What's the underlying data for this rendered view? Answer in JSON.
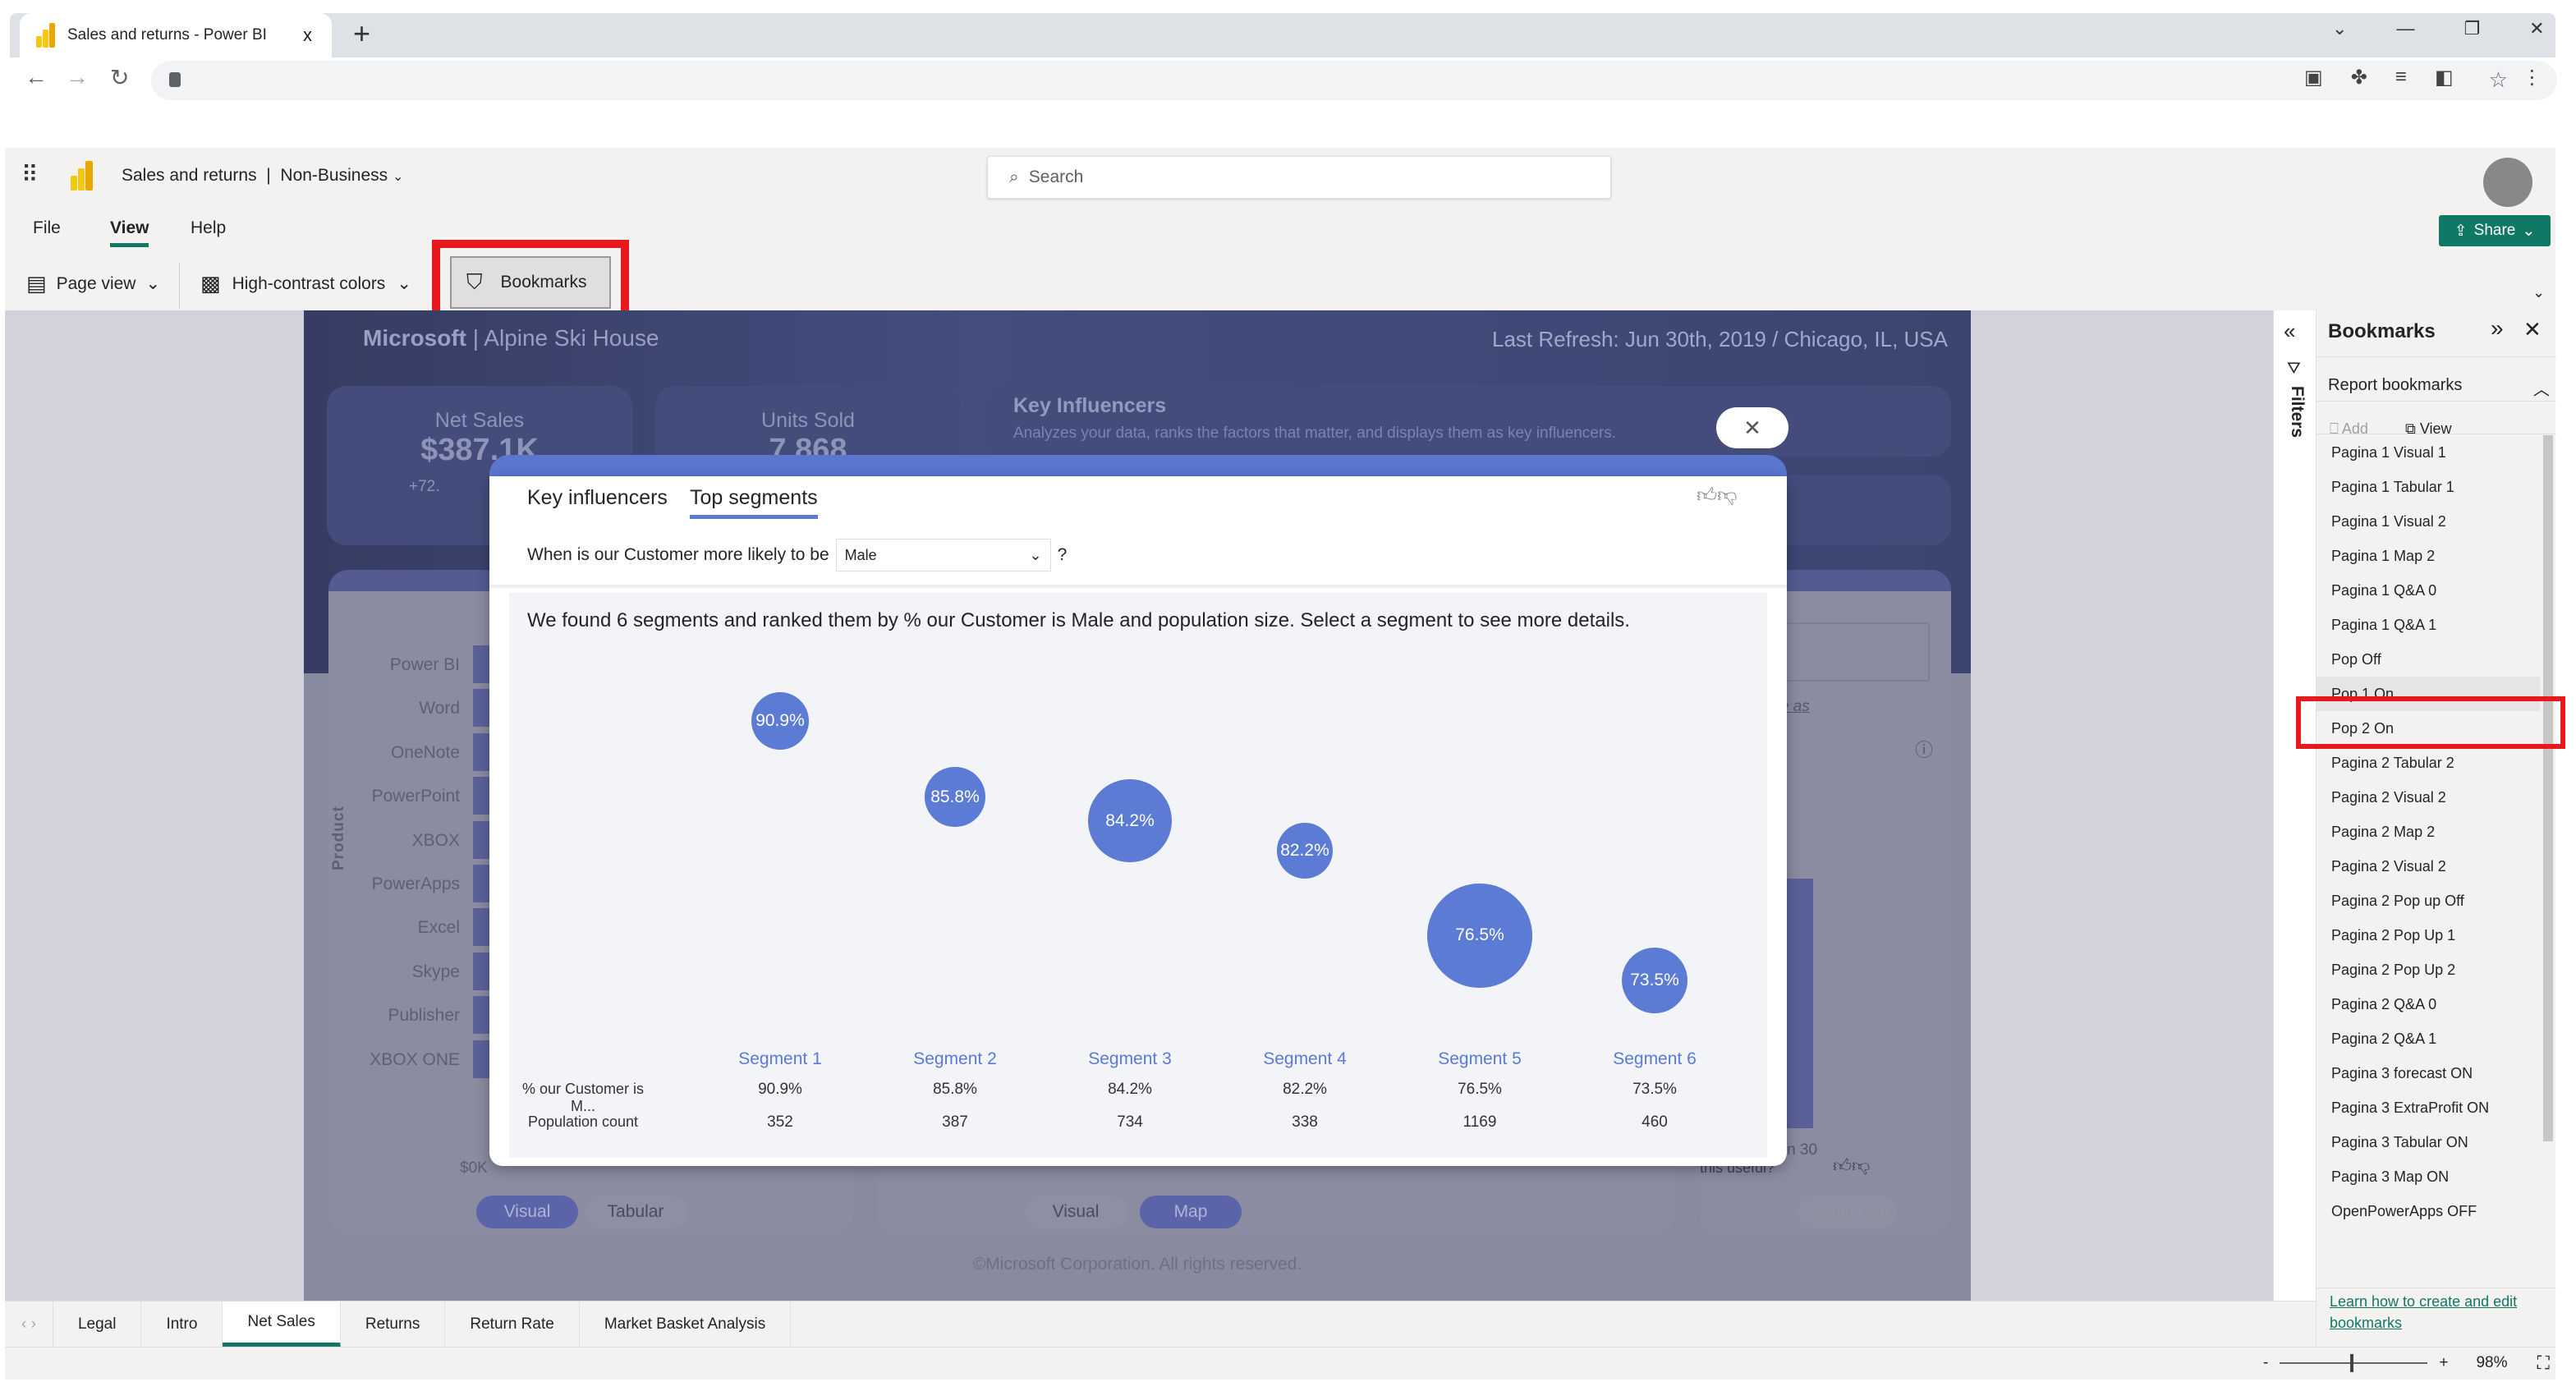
{
  "browser": {
    "tab_title": "Sales and returns - Power BI",
    "close": "x",
    "new_tab": "+",
    "win_controls": [
      "⌄",
      "—",
      "❐",
      "✕"
    ]
  },
  "app": {
    "title": "Sales and returns",
    "workspace": "Non-Business",
    "search_placeholder": "Search",
    "share": "Share",
    "menu": [
      "File",
      "View",
      "Help"
    ],
    "active_menu": "View",
    "toolbar": {
      "page_view": "Page view",
      "high_contrast": "High-contrast colors",
      "bookmarks": "Bookmarks"
    }
  },
  "report": {
    "brand": "Microsoft",
    "subbrand": "Alpine Ski House",
    "last_refresh": "Last Refresh: Jun 30th, 2019 / Chicago, IL, USA",
    "kpis": [
      {
        "label": "Net Sales",
        "value": "$387.1K",
        "sub": "+72.",
        "sub2": "-- "
      },
      {
        "label": "Units Sold",
        "value": "7,868"
      }
    ],
    "ki_title": "Key Influencers",
    "ki_desc": "Analyzes your data, ranks the factors that matter, and displays them as key influencers.",
    "products": [
      "Power BI",
      "Word",
      "OneNote",
      "PowerPoint",
      "XBOX",
      "PowerApps",
      "Excel",
      "Skype",
      "Publisher",
      "XBOX ONE"
    ],
    "product_axis": "Product",
    "axis_zero": "$0K",
    "date_label": "Jun 30",
    "link_text": "by sale date as",
    "useful": "this useful?",
    "card1_buttons": [
      "Visual",
      "Tabular"
    ],
    "card2_buttons": [
      "Visual",
      "Map"
    ],
    "card3_button": "Restart Q&A",
    "footer": "©Microsoft Corporation. All rights reserved."
  },
  "popup": {
    "close": "✕",
    "tabs": [
      "Key influencers",
      "Top segments"
    ],
    "active_tab": "Top segments",
    "question_prefix": "When is our Customer more likely to be",
    "question_value": "Male",
    "question_suffix": "?",
    "summary": "We found 6 segments and ranked them by % our Customer is Male and population size. Select a segment to see more details.",
    "row_labels": [
      "% our Customer is M...",
      "Population count"
    ],
    "segments": [
      {
        "name": "Segment 1",
        "pct": 90.9,
        "pct_label": "90.9%",
        "population": 352
      },
      {
        "name": "Segment 2",
        "pct": 85.8,
        "pct_label": "85.8%",
        "population": 387
      },
      {
        "name": "Segment 3",
        "pct": 84.2,
        "pct_label": "84.2%",
        "population": 734
      },
      {
        "name": "Segment 4",
        "pct": 82.2,
        "pct_label": "82.2%",
        "population": 338
      },
      {
        "name": "Segment 5",
        "pct": 76.5,
        "pct_label": "76.5%",
        "population": 1169
      },
      {
        "name": "Segment 6",
        "pct": 73.5,
        "pct_label": "73.5%",
        "population": 460
      }
    ],
    "bubble_color": "#5b7bd5"
  },
  "filters": {
    "label": "Filters"
  },
  "bookmarks": {
    "title": "Bookmarks",
    "section": "Report bookmarks",
    "add": "Add",
    "view": "View",
    "selected": "Pop 1 On",
    "items": [
      "Pagina 1 Visual 1",
      "Pagina 1 Tabular 1",
      "Pagina 1 Visual 2",
      "Pagina 1 Map 2",
      "Pagina 1 Q&A 0",
      "Pagina 1 Q&A 1",
      "Pop Off",
      "Pop 1 On",
      "Pop 2 On",
      "Pagina 2 Tabular 2",
      "Pagina 2 Visual 2",
      "Pagina 2 Map 2",
      "Pagina 2 Visual 2",
      "Pagina 2 Pop up Off",
      "Pagina 2 Pop Up 1",
      "Pagina 2 Pop Up 2",
      "Pagina 2 Q&A 0",
      "Pagina 2 Q&A 1",
      "Pagina 3 forecast ON",
      "Pagina 3 ExtraProfit ON",
      "Pagina 3 Tabular ON",
      "Pagina 3 Map ON",
      "OpenPowerApps OFF"
    ],
    "learn_link": "Learn how to create and edit bookmarks"
  },
  "pages": {
    "tabs": [
      "Legal",
      "Intro",
      "Net Sales",
      "Returns",
      "Return Rate",
      "Market Basket Analysis"
    ],
    "active": "Net Sales"
  },
  "status": {
    "zoom": "98%",
    "minus": "-",
    "plus": "+"
  },
  "highlight_color": "#e8191c"
}
